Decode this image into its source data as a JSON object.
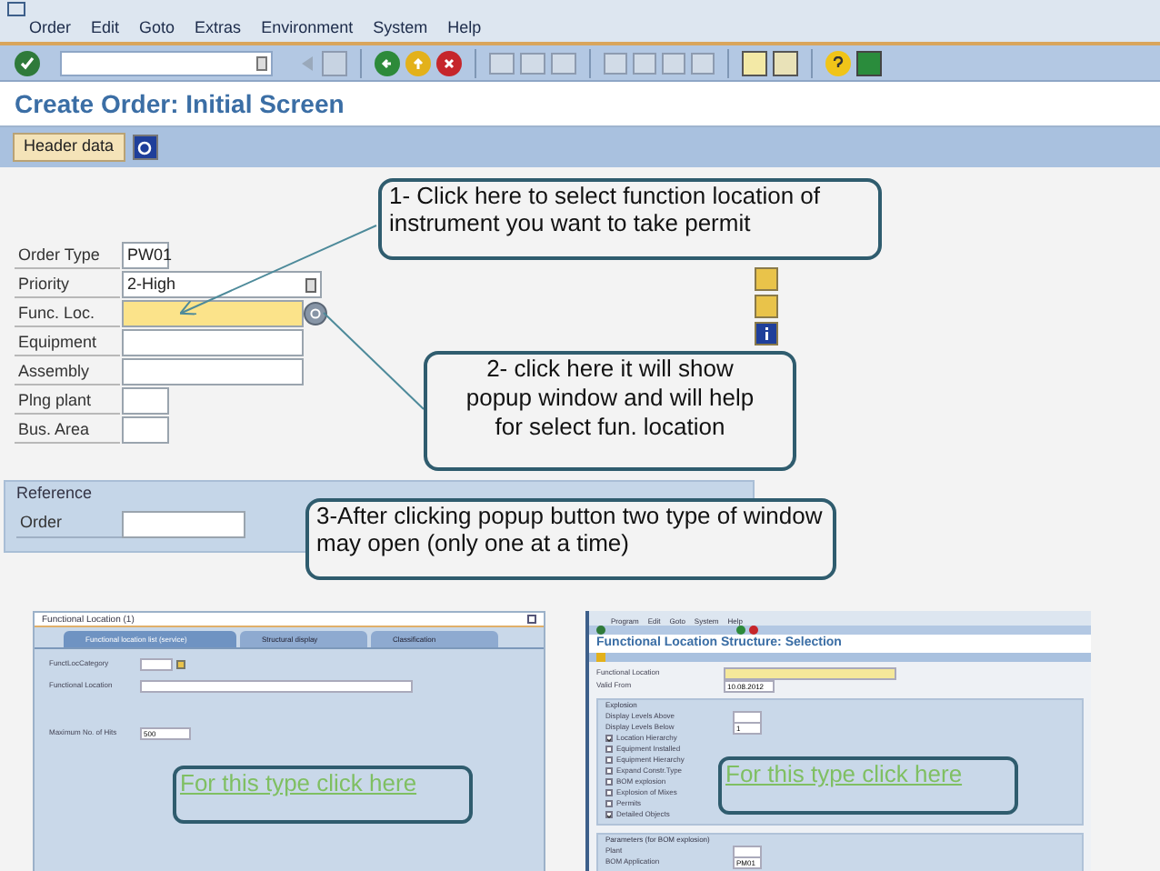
{
  "menu": [
    "Order",
    "Edit",
    "Goto",
    "Extras",
    "Environment",
    "System",
    "Help"
  ],
  "screen_title": "Create Order: Initial Screen",
  "header_button": "Header data",
  "form": [
    {
      "label": "Order Type",
      "value": "PW01",
      "kind": "short"
    },
    {
      "label": "Priority",
      "value": "2-High",
      "kind": "dropdown"
    },
    {
      "label": "Func. Loc.",
      "kind": "lookup"
    },
    {
      "label": "Equipment",
      "kind": "long"
    },
    {
      "label": "Assembly",
      "kind": "long"
    },
    {
      "label": "Plng plant",
      "kind": "short"
    },
    {
      "label": "Bus. Area",
      "kind": "short"
    }
  ],
  "reference": {
    "title": "Reference",
    "fields": [
      {
        "label": "Order"
      }
    ]
  },
  "callouts": [
    "1- Click here to select function location   of instrument you want to take permit",
    "2- click here it will show popup window and will help for select fun. location",
    "3-After clicking popup button two type of window may open (only one at a time)"
  ],
  "popups": [
    {
      "kind": "dialog",
      "title": "Functional Location (1)",
      "tabs": [
        {
          "label": "Functional location list (service)",
          "selected": true
        },
        {
          "label": "Structural display",
          "selected": false
        },
        {
          "label": "Classification",
          "selected": false
        }
      ],
      "fields": [
        {
          "label": "FunctLocCategory",
          "kind": "dropdown"
        },
        {
          "label": "Functional Location",
          "kind": "long"
        },
        {
          "label": "Maximum No. of Hits",
          "value": "500",
          "kind": "short"
        }
      ],
      "link": "For this type click here"
    },
    {
      "kind": "screen",
      "menu": [
        "Program",
        "Edit",
        "Goto",
        "System",
        "Help"
      ],
      "title": "Functional Location Structure: Selection",
      "fields": [
        {
          "label": "Functional Location",
          "kind": "lookup"
        },
        {
          "label": "Valid From",
          "value": "10.08.2012",
          "kind": "short"
        }
      ],
      "groups": [
        {
          "title": "Explosion",
          "items": [
            {
              "label": "Display Levels Above",
              "kind": "number"
            },
            {
              "label": "Display Levels Below",
              "value": "1",
              "kind": "number"
            },
            {
              "label": "Location Hierarchy",
              "kind": "check",
              "checked": true
            },
            {
              "label": "Equipment Installed",
              "kind": "check",
              "checked": false
            },
            {
              "label": "Equipment Hierarchy",
              "kind": "check",
              "checked": false
            },
            {
              "label": "Expand Constr.Type",
              "kind": "check",
              "checked": false
            },
            {
              "label": "BOM explosion",
              "kind": "check",
              "checked": false
            },
            {
              "label": "Explosion of Mixes",
              "kind": "check",
              "checked": false
            },
            {
              "label": "Permits",
              "kind": "check",
              "checked": false
            },
            {
              "label": "Detailed Objects",
              "kind": "check",
              "checked": true
            }
          ]
        },
        {
          "title": "Parameters (for BOM explosion)",
          "items": [
            {
              "label": "Plant",
              "kind": "number"
            },
            {
              "label": "BOM Application",
              "value": "PM01",
              "kind": "number"
            }
          ]
        }
      ],
      "link": "For this type click here"
    }
  ]
}
